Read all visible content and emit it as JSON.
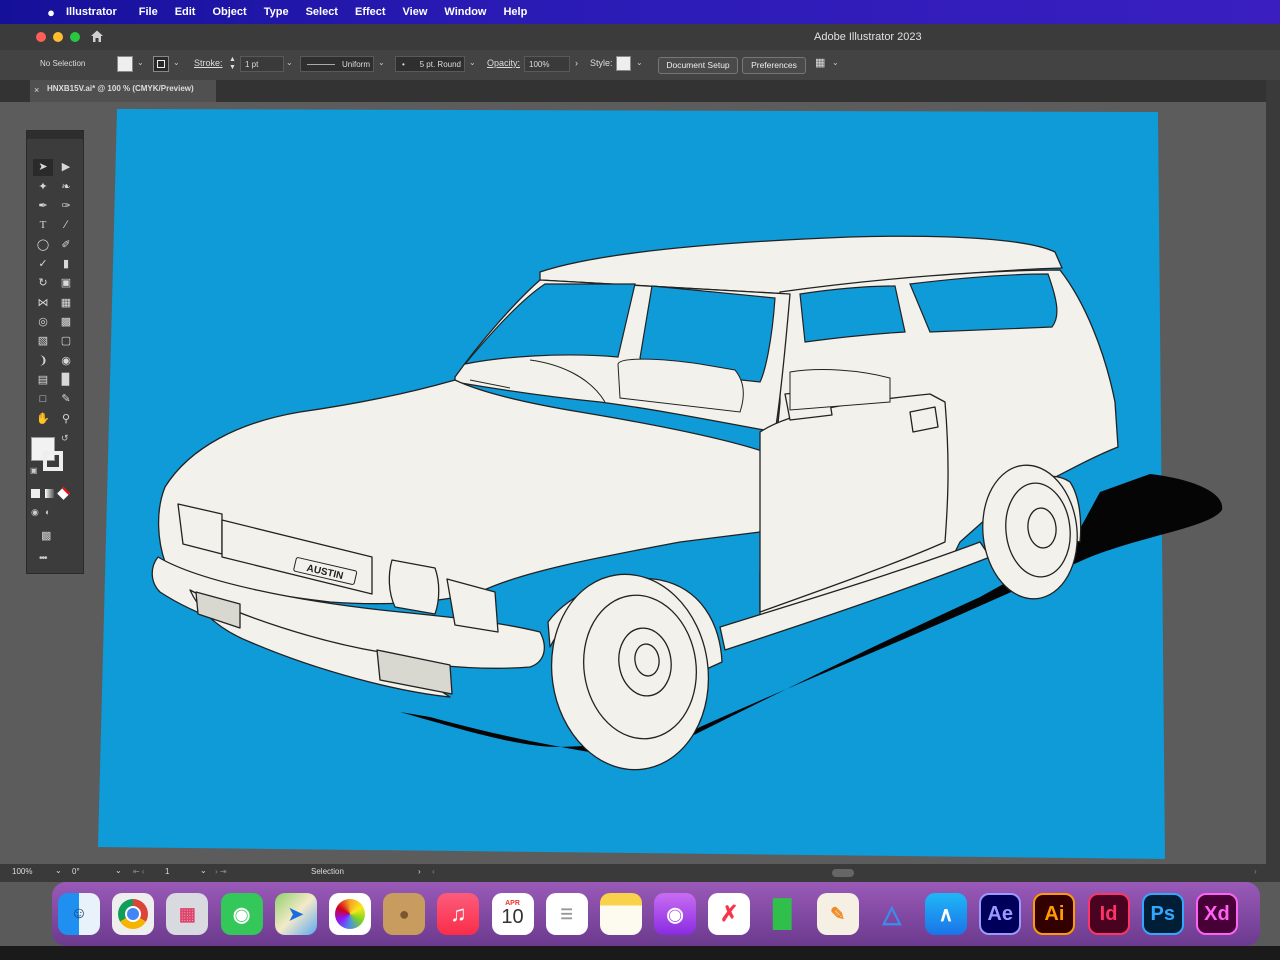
{
  "menubar": {
    "app_name": "Illustrator",
    "items": [
      "File",
      "Edit",
      "Object",
      "Type",
      "Select",
      "Effect",
      "View",
      "Window",
      "Help"
    ]
  },
  "titlebar": {
    "title": "Adobe Illustrator 2023"
  },
  "controlbar": {
    "selection_status": "No Selection",
    "stroke_label": "Stroke:",
    "stroke_weight": "1 pt",
    "profile": "Uniform",
    "brush": "5 pt. Round",
    "opacity_label": "Opacity:",
    "opacity_value": "100%",
    "style_label": "Style:",
    "document_setup": "Document Setup",
    "preferences": "Preferences"
  },
  "document": {
    "tab_title": "HNXB15V.ai* @ 100 % (CMYK/Preview)"
  },
  "artwork": {
    "grille_badge": "AUSTIN",
    "background_color": "#0f9ad8",
    "body_color": "#f2f1ec",
    "shadow_color": "#050505"
  },
  "statusbar": {
    "zoom": "100%",
    "rotation": "0°",
    "artboard_number": "1",
    "tool_status": "Selection"
  },
  "dock": {
    "items": [
      {
        "icon": "finder-icon"
      },
      {
        "icon": "chrome-icon"
      },
      {
        "icon": "launchpad-icon"
      },
      {
        "icon": "messages-icon"
      },
      {
        "icon": "maps-icon"
      },
      {
        "icon": "photos-icon"
      },
      {
        "icon": "contacts-icon"
      },
      {
        "icon": "music-icon"
      },
      {
        "icon": "calendar-icon",
        "month": "APR",
        "day": "10"
      },
      {
        "icon": "reminders-icon"
      },
      {
        "icon": "notes-icon"
      },
      {
        "icon": "podcasts-icon"
      },
      {
        "icon": "news-icon"
      },
      {
        "icon": "numbers-icon"
      },
      {
        "icon": "pages-icon"
      },
      {
        "icon": "keynote-icon"
      },
      {
        "icon": "app-store-icon"
      },
      {
        "icon": "after-effects-icon",
        "label": "Ae"
      },
      {
        "icon": "illustrator-icon",
        "label": "Ai"
      },
      {
        "icon": "indesign-icon",
        "label": "Id"
      },
      {
        "icon": "photoshop-icon",
        "label": "Ps"
      },
      {
        "icon": "xd-icon",
        "label": "Xd"
      }
    ]
  }
}
